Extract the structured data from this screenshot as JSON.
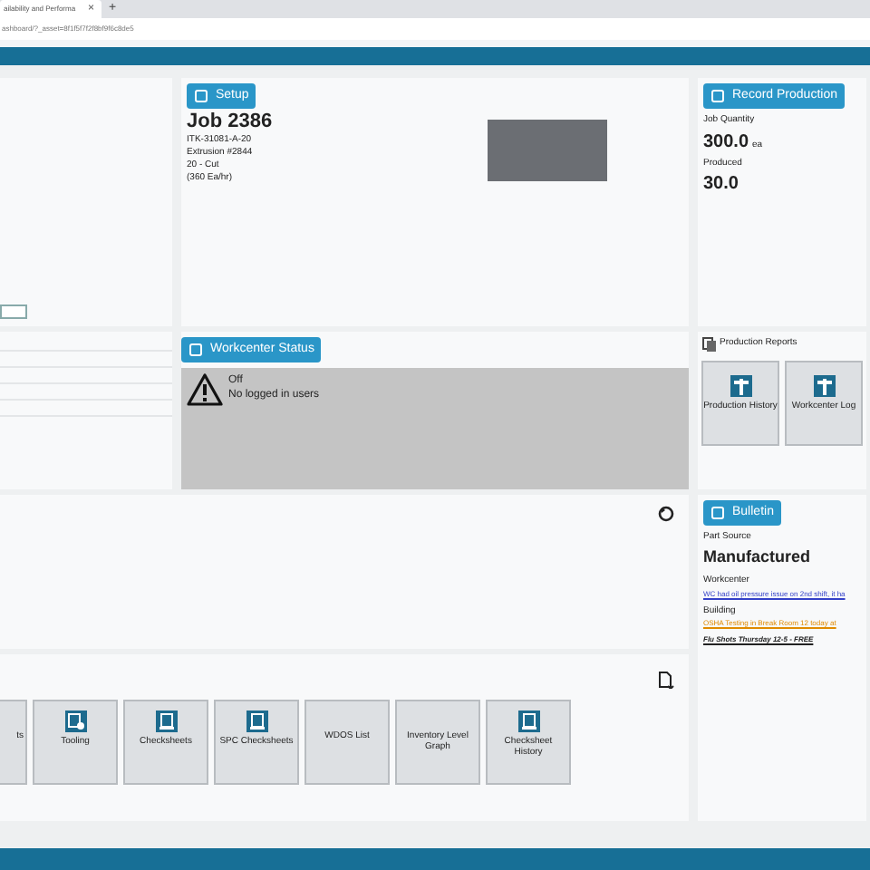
{
  "browser": {
    "tab_title": "ailability and Performa",
    "tab_close": "×",
    "new_tab": "+",
    "url": "ashboard/?_asset=8f1f5f7f2f8bf9f6c8de5"
  },
  "setup": {
    "button": "Setup",
    "job": "Job 2386",
    "lines": [
      "ITK-31081-A-20",
      "Extrusion #2844",
      "20 - Cut",
      "(360 Ea/hr)"
    ]
  },
  "record_production": {
    "button": "Record Production",
    "job_quantity_label": "Job Quantity",
    "job_quantity": "300.0",
    "unit": "ea",
    "produced_label": "Produced",
    "produced": "30.0"
  },
  "workcenter_status": {
    "button": "Workcenter Status",
    "state": "Off",
    "users": "No logged in users"
  },
  "production_reports": {
    "title": "Production Reports",
    "tiles": [
      {
        "label": "Production History"
      },
      {
        "label": "Workcenter Log"
      }
    ]
  },
  "bulletin": {
    "button": "Bulletin",
    "part_source_label": "Part Source",
    "part_source": "Manufactured",
    "workcenter_label": "Workcenter",
    "workcenter_note": "WC had oil pressure issue on 2nd shift, it ha",
    "building_label": "Building",
    "building_note": "OSHA Testing in Break Room 12 today at",
    "note": "Flu Shots Thursday 12-5 - FREE"
  },
  "tools": [
    {
      "label": "ts",
      "kind": "blank"
    },
    {
      "label": "Tooling",
      "kind": "tooling"
    },
    {
      "label": "Checksheets",
      "kind": "sheet"
    },
    {
      "label": "SPC Checksheets",
      "kind": "sheet"
    },
    {
      "label": "WDOS List",
      "kind": "blank"
    },
    {
      "label": "Inventory Level Graph",
      "kind": "blank"
    },
    {
      "label": "Checksheet History",
      "kind": "sheet"
    }
  ]
}
